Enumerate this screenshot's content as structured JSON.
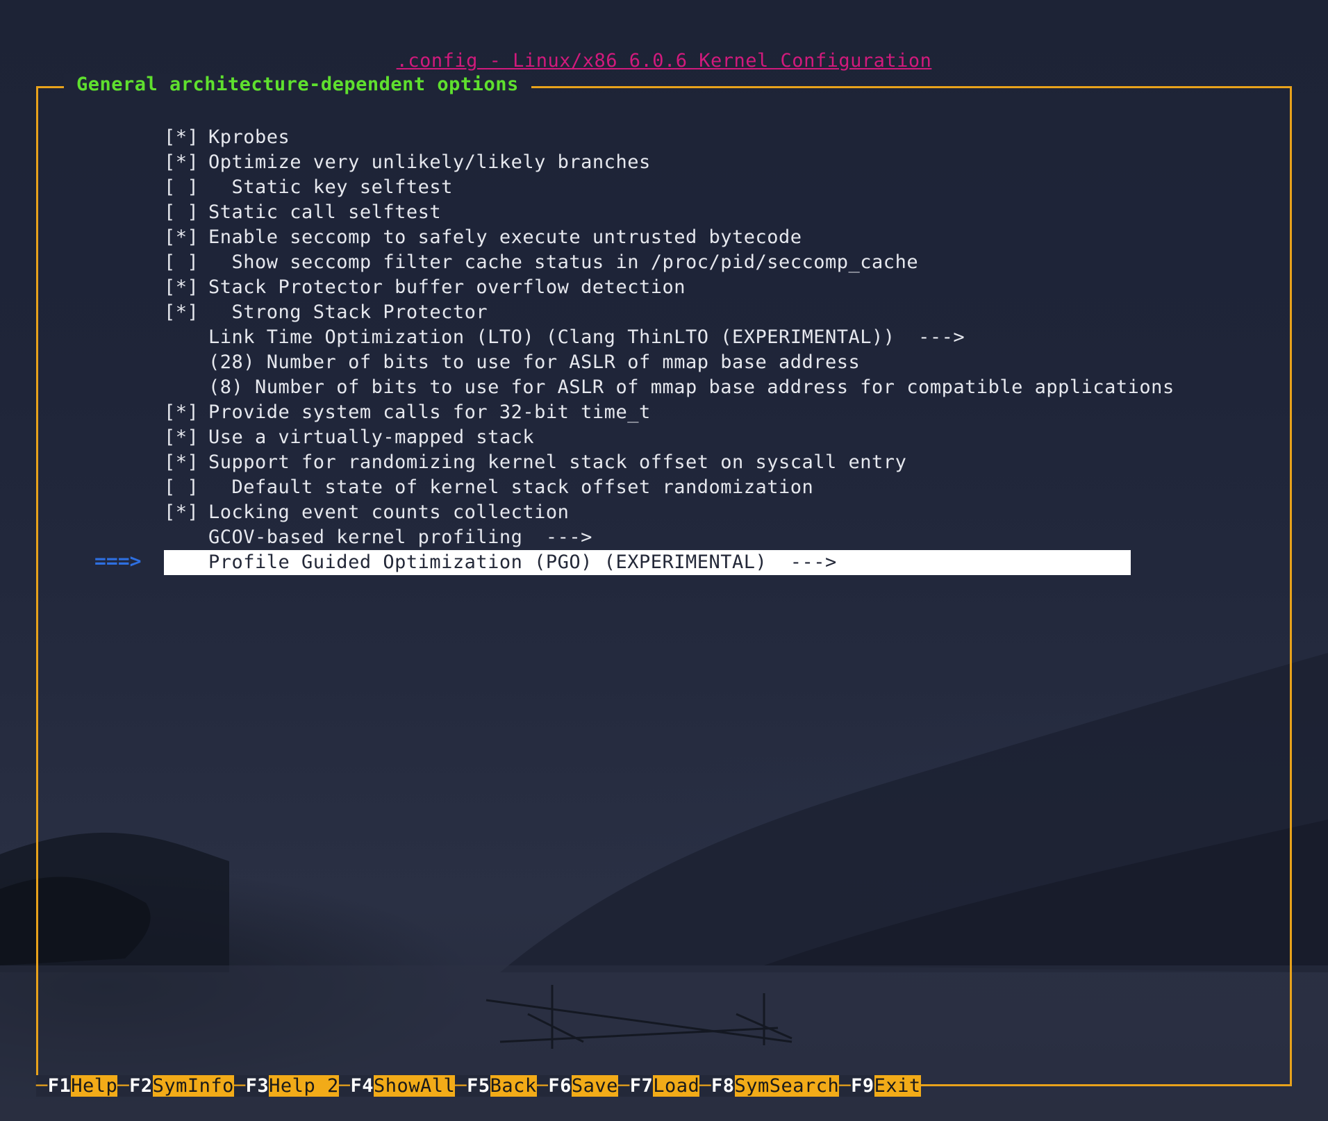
{
  "title": ".config - Linux/x86 6.0.6 Kernel Configuration",
  "menu_title": "General architecture-dependent options",
  "cursor": "===>",
  "items": [
    {
      "mark": "[*]",
      "label": "Kprobes"
    },
    {
      "mark": "[*]",
      "label": "Optimize very unlikely/likely branches"
    },
    {
      "mark": "[ ]",
      "label": "  Static key selftest"
    },
    {
      "mark": "[ ]",
      "label": "Static call selftest"
    },
    {
      "mark": "[*]",
      "label": "Enable seccomp to safely execute untrusted bytecode"
    },
    {
      "mark": "[ ]",
      "label": "  Show seccomp filter cache status in /proc/pid/seccomp_cache"
    },
    {
      "mark": "[*]",
      "label": "Stack Protector buffer overflow detection"
    },
    {
      "mark": "[*]",
      "label": "  Strong Stack Protector"
    },
    {
      "mark": "",
      "label": "Link Time Optimization (LTO) (Clang ThinLTO (EXPERIMENTAL))  --->"
    },
    {
      "mark": "",
      "label": "(28) Number of bits to use for ASLR of mmap base address"
    },
    {
      "mark": "",
      "label": "(8) Number of bits to use for ASLR of mmap base address for compatible applications"
    },
    {
      "mark": "[*]",
      "label": "Provide system calls for 32-bit time_t"
    },
    {
      "mark": "[*]",
      "label": "Use a virtually-mapped stack"
    },
    {
      "mark": "[*]",
      "label": "Support for randomizing kernel stack offset on syscall entry"
    },
    {
      "mark": "[ ]",
      "label": "  Default state of kernel stack offset randomization"
    },
    {
      "mark": "[*]",
      "label": "Locking event counts collection"
    },
    {
      "mark": "",
      "label": "GCOV-based kernel profiling  --->"
    },
    {
      "mark": "",
      "label": "Profile Guided Optimization (PGO) (EXPERIMENTAL)  --->",
      "selected": true
    }
  ],
  "function_keys": [
    {
      "key": "F1",
      "label": "Help"
    },
    {
      "key": "F2",
      "label": "SymInfo"
    },
    {
      "key": "F3",
      "label": "Help 2"
    },
    {
      "key": "F4",
      "label": "ShowAll"
    },
    {
      "key": "F5",
      "label": "Back"
    },
    {
      "key": "F6",
      "label": "Save"
    },
    {
      "key": "F7",
      "label": "Load"
    },
    {
      "key": "F8",
      "label": "SymSearch"
    },
    {
      "key": "F9",
      "label": "Exit"
    }
  ],
  "colors": {
    "title": "#d11a7c",
    "frame": "#e8a21b",
    "menu_title": "#5fe02e",
    "cursor": "#2e6fe0",
    "selection_bg": "#ffffff",
    "fkey_label_bg": "#f2ab18"
  }
}
